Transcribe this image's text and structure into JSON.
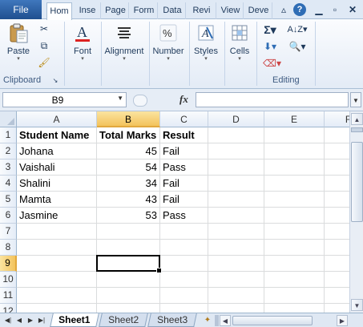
{
  "ribbon": {
    "tabs": [
      "File",
      "Hom",
      "Inse",
      "Page",
      "Form",
      "Data",
      "Revi",
      "View",
      "Deve"
    ],
    "active_tab": "Hom",
    "groups": {
      "clipboard": {
        "label": "Clipboard",
        "paste_label": "Paste"
      },
      "font": {
        "label": "Font"
      },
      "alignment": {
        "label": "Alignment"
      },
      "number": {
        "label": "Number"
      },
      "styles": {
        "label": "Styles"
      },
      "cells": {
        "label": "Cells"
      },
      "editing": {
        "label": "Editing"
      }
    }
  },
  "formula_bar": {
    "name_box": "B9",
    "fx_label": "fx",
    "formula": ""
  },
  "columns": [
    "A",
    "B",
    "C",
    "D",
    "E",
    "F"
  ],
  "selected_column": "B",
  "rows": [
    {
      "num": "1",
      "cells": [
        "Student Name",
        "Total Marks",
        "Result"
      ]
    },
    {
      "num": "2",
      "cells": [
        "Johana",
        "45",
        "Fail"
      ]
    },
    {
      "num": "3",
      "cells": [
        "Vaishali",
        "54",
        "Pass"
      ]
    },
    {
      "num": "4",
      "cells": [
        "Shalini",
        "34",
        "Fail"
      ]
    },
    {
      "num": "5",
      "cells": [
        "Mamta",
        "43",
        "Fail"
      ]
    },
    {
      "num": "6",
      "cells": [
        "Jasmine",
        "53",
        "Pass"
      ]
    },
    {
      "num": "7",
      "cells": [
        "",
        "",
        ""
      ]
    },
    {
      "num": "8",
      "cells": [
        "",
        "",
        ""
      ]
    },
    {
      "num": "9",
      "cells": [
        "",
        "",
        ""
      ]
    },
    {
      "num": "10",
      "cells": [
        "",
        "",
        ""
      ]
    },
    {
      "num": "11",
      "cells": [
        "",
        "",
        ""
      ]
    },
    {
      "num": "12",
      "cells": [
        "",
        "",
        ""
      ]
    }
  ],
  "selected_row": "9",
  "active_cell": "B9",
  "sheets": [
    "Sheet1",
    "Sheet2",
    "Sheet3"
  ],
  "active_sheet": "Sheet1",
  "colors": {
    "selection_header": "#f3c35c",
    "file_tab": "#2a5c9a"
  }
}
